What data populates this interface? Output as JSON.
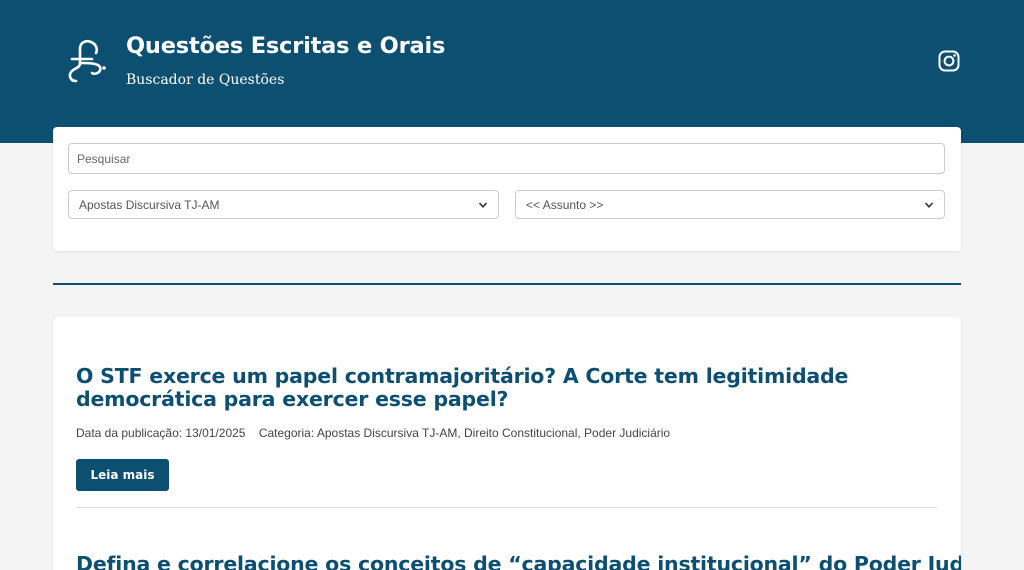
{
  "header": {
    "title": "Questões Escritas e Orais",
    "subtitle": "Buscador de Questões",
    "logo_icon": "fe-monogram-logo",
    "social_icon": "instagram-icon",
    "background": "#0c4f71"
  },
  "search": {
    "placeholder": "Pesquisar",
    "value": "",
    "category_select": "Apostas Discursiva TJ-AM",
    "subject_select": "<< Assunto >>"
  },
  "posts": [
    {
      "title": "O STF exerce um papel contramajoritário? A Corte tem legitimidade democrática para exercer esse papel?",
      "date": "Data da publicação: 13/01/2025",
      "category": "Categoria: Apostas Discursiva TJ-AM, Direito Constitucional, Poder Judiciário",
      "read_more": "Leia mais"
    },
    {
      "title": "Defina e correlacione os conceitos de “capacidade institucional” do Poder Judiciário e"
    }
  ],
  "colors": {
    "accent": "#0c4f71",
    "page_background": "#f4f4f4"
  }
}
